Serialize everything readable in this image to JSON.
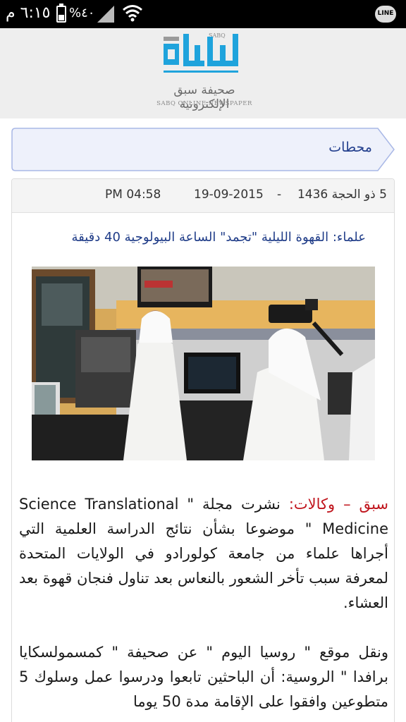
{
  "status_bar": {
    "time": "٦:١٥ م",
    "battery_percent": "%٤٠",
    "battery_level": 0.4,
    "app_badge": "LINE"
  },
  "header": {
    "logo_small": "SABQ",
    "logo_arabic": "صحيفة سبق الإلكترونية",
    "logo_latin": "SABQ ONLINE NEWSPAPER"
  },
  "section": {
    "title": "محطات"
  },
  "article": {
    "hijri_date": "5 ذو الحجة 1436",
    "separator": "-",
    "gregorian_date": "19-09-2015",
    "time": "PM 04:58",
    "headline": "علماء: القهوة الليلية \"تجمد\" الساعة البيولوجية 40 دقيقة",
    "photo_name": "studio-photo",
    "lead": "سبق – وكالات:",
    "paragraph1": " نشرت مجلة \" Science Translational Medicine \" موضوعا بشأن نتائج الدراسة العلمية التي أجراها علماء من جامعة كولورادو في الولايات المتحدة لمعرفة سبب تأخر الشعور بالنعاس بعد تناول فنجان قهوة بعد العشاء.",
    "paragraph2": "ونقل موقع \" روسيا اليوم \" عن صحيفة \" كمسمولسكايا برافدا \" الروسية: أن الباحثين تابعوا ودرسوا عمل وسلوك 5 متطوعين وافقوا على الإقامة مدة 50 يوما"
  },
  "colors": {
    "status_bg": "#000000",
    "header_bg": "#eeeeee",
    "banner_fill": "#eef1fb",
    "banner_border": "#a9b8e6",
    "link_blue": "#1f3c88",
    "lead_red": "#c0151d",
    "logo_blue": "#1fa3dc"
  }
}
